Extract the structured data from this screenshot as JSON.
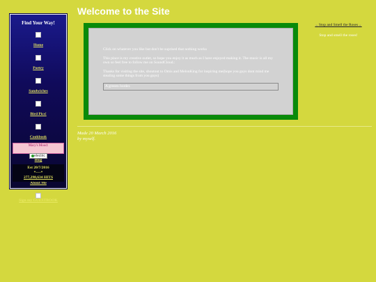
{
  "page": {
    "title": "Welcome to the Site"
  },
  "sidebar": {
    "heading": "Find Your Way!",
    "items": [
      {
        "label": "Home"
      },
      {
        "label": "Poetry"
      },
      {
        "label": "Sandwiches"
      },
      {
        "label": "Bird Pics!"
      },
      {
        "label": "Cookbook"
      },
      {
        "label": "Blog"
      },
      {
        "label": "About Me"
      }
    ],
    "guestbook": "Sign my GUESTBOOK",
    "mood": {
      "label": "Mary's Mood:",
      "badge": "electric"
    },
    "est": {
      "date": "Est 20/7/2016",
      "sep": "*----*",
      "hits": "277,298,634 HITS"
    }
  },
  "main": {
    "paragraphs": [
      "Click on whatever you like but don't be suprised that nothing works",
      "This place is my creative outlet, so hope you enjoy it as much as I have enjoyed making it. The music is all my own so feel free to follow me on SoundCloud.:",
      "Thanks for visiting the site, shoutout to Omis and MelonKing for inspiring me(hope you guys dont mind me stealing some things from you guys)"
    ],
    "green_border": "A greeen border."
  },
  "right": {
    "title": "Stop and Smell the Roses",
    "arrow_left": "←",
    "arrow_right": "→",
    "subtitle": "Stop and smell the roses!"
  },
  "footer": {
    "made": "Made 20 March 2016",
    "by": "by myself."
  }
}
